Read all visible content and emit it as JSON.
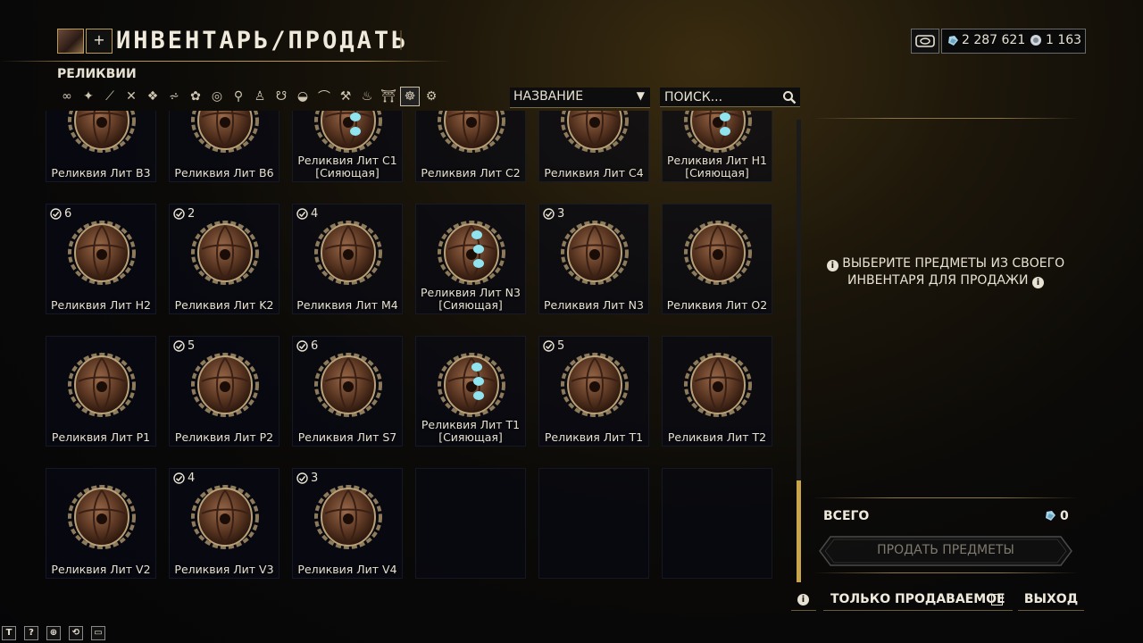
{
  "header": {
    "title": "ИНВЕНТАРЬ/ПРОДАТЬ",
    "category": "РЕЛИКВИИ",
    "plus_label": "+"
  },
  "currency": {
    "platinum_icon": "platinum-icon",
    "platinum": "2 287 621",
    "endo_icon": "endo-icon",
    "endo": "1 163"
  },
  "filters": [
    {
      "icon": "infinity-icon",
      "glyph": "∞"
    },
    {
      "icon": "warframe-icon",
      "glyph": "✦"
    },
    {
      "icon": "primary-weapon-icon",
      "glyph": "⟋"
    },
    {
      "icon": "secondary-weapon-icon",
      "glyph": "✕"
    },
    {
      "icon": "mod-icon",
      "glyph": "❖"
    },
    {
      "icon": "archwing-icon",
      "glyph": "⩫"
    },
    {
      "icon": "companion-icon",
      "glyph": "✿"
    },
    {
      "icon": "sentinel-icon",
      "glyph": "◎"
    },
    {
      "icon": "key-icon",
      "glyph": "⚲"
    },
    {
      "icon": "amp-icon",
      "glyph": "♙"
    },
    {
      "icon": "kubrow-icon",
      "glyph": "☋"
    },
    {
      "icon": "fish-icon",
      "glyph": "◒"
    },
    {
      "icon": "bow-icon",
      "glyph": "⌒"
    },
    {
      "icon": "tool-icon",
      "glyph": "⚒"
    },
    {
      "icon": "resource-icon",
      "glyph": "♨"
    },
    {
      "icon": "decoration-icon",
      "glyph": "⛩"
    },
    {
      "icon": "relic-icon",
      "glyph": "☸",
      "active": true
    },
    {
      "icon": "misc-icon",
      "glyph": "⚙"
    }
  ],
  "sort": {
    "label": "НАЗВАНИЕ",
    "arrow": "▼"
  },
  "search": {
    "placeholder": "ПОИСК..."
  },
  "colors": {
    "accent": "#c8a44a",
    "text": "#e8e2d2",
    "radiant_glow": "#8fe4f0"
  },
  "tiles": [
    {
      "name": "Реликвия Лит B3",
      "count": "",
      "radiant": false
    },
    {
      "name": "Реликвия Лит B6",
      "count": "",
      "radiant": false
    },
    {
      "name": "Реликвия Лит C1 [Сияющая]",
      "count": "",
      "radiant": true
    },
    {
      "name": "Реликвия Лит C2",
      "count": "",
      "radiant": false
    },
    {
      "name": "Реликвия Лит C4",
      "count": "",
      "radiant": false
    },
    {
      "name": "Реликвия Лит H1 [Сияющая]",
      "count": "",
      "radiant": true
    },
    {
      "name": "Реликвия Лит H2",
      "count": "6",
      "radiant": false
    },
    {
      "name": "Реликвия Лит K2",
      "count": "2",
      "radiant": false
    },
    {
      "name": "Реликвия Лит M4",
      "count": "4",
      "radiant": false
    },
    {
      "name": "Реликвия Лит N3 [Сияющая]",
      "count": "",
      "radiant": true
    },
    {
      "name": "Реликвия Лит N3",
      "count": "3",
      "radiant": false
    },
    {
      "name": "Реликвия Лит O2",
      "count": "",
      "radiant": false
    },
    {
      "name": "Реликвия Лит P1",
      "count": "",
      "radiant": false
    },
    {
      "name": "Реликвия Лит P2",
      "count": "5",
      "radiant": false
    },
    {
      "name": "Реликвия Лит S7",
      "count": "6",
      "radiant": false
    },
    {
      "name": "Реликвия Лит T1 [Сияющая]",
      "count": "",
      "radiant": true
    },
    {
      "name": "Реликвия Лит T1",
      "count": "5",
      "radiant": false
    },
    {
      "name": "Реликвия Лит T2",
      "count": "",
      "radiant": false
    },
    {
      "name": "Реликвия Лит V2",
      "count": "",
      "radiant": false
    },
    {
      "name": "Реликвия Лит V3",
      "count": "4",
      "radiant": false
    },
    {
      "name": "Реликвия Лит V4",
      "count": "3",
      "radiant": false
    },
    {
      "empty": true
    },
    {
      "empty": true
    },
    {
      "empty": true
    }
  ],
  "right_panel": {
    "message": "ВЫБЕРИТЕ ПРЕДМЕТЫ ИЗ СВОЕГО ИНВЕНТАРЯ ДЛЯ ПРОДАЖИ",
    "total_label": "ВСЕГО",
    "total_value": "0",
    "sell_button": "ПРОДАТЬ ПРЕДМЕТЫ"
  },
  "footer": {
    "info_icon": "info-icon",
    "sellable_label": "ТОЛЬКО ПРОДАВАЕМОЕ",
    "sellable_checked": false,
    "exit_label": "ВЫХОД",
    "keys": [
      "T",
      "?",
      "⊕",
      "⟲",
      "▭"
    ]
  }
}
